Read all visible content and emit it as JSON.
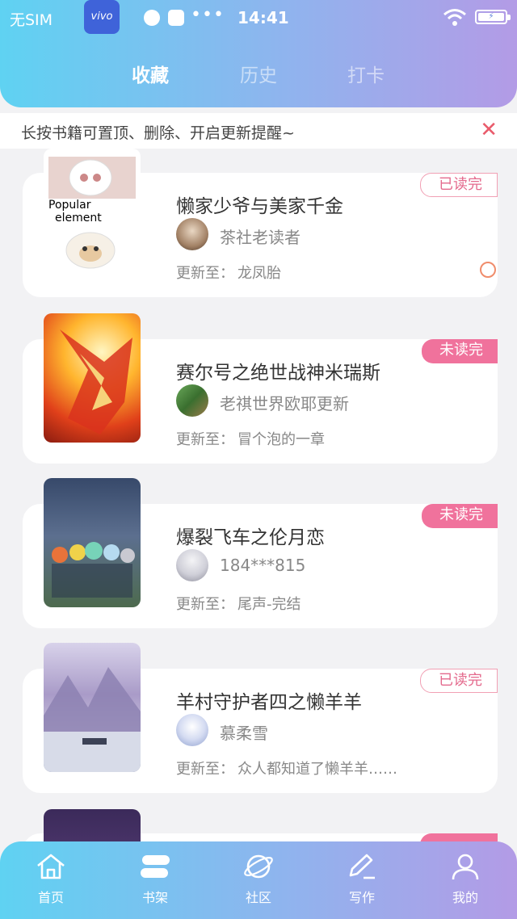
{
  "status_bar": {
    "carrier": "无SIM",
    "brand": "vivo",
    "time": "14:41"
  },
  "tabs": [
    {
      "label": "收藏",
      "active": true
    },
    {
      "label": "历史",
      "active": false
    },
    {
      "label": "打卡",
      "active": false
    }
  ],
  "notice": {
    "text": "长按书籍可置顶、删除、开启更新提醒~"
  },
  "update_prefix": "更新至：",
  "books": [
    {
      "title": "懒家少爷与美家千金",
      "author": "茶社老读者",
      "update": "龙凤胎",
      "status": "已读完",
      "read": true,
      "cover_text_1": "Popular",
      "cover_text_2": "element"
    },
    {
      "title": "赛尔号之绝世战神米瑞斯",
      "author": "老祺世界欧耶更新",
      "update": "冒个泡的一章",
      "status": "未读完",
      "read": false
    },
    {
      "title": "爆裂飞车之伦月恋",
      "author": "184***815",
      "update": "尾声-完结",
      "status": "未读完",
      "read": false
    },
    {
      "title": "羊村守护者四之懒羊羊",
      "author": "慕柔雪",
      "update": "众人都知道了懒羊羊……",
      "status": "已读完",
      "read": true
    }
  ],
  "nav": [
    {
      "label": "首页",
      "icon": "home-icon"
    },
    {
      "label": "书架",
      "icon": "bookshelf-icon"
    },
    {
      "label": "社区",
      "icon": "planet-icon"
    },
    {
      "label": "写作",
      "icon": "pen-icon"
    },
    {
      "label": "我的",
      "icon": "user-icon"
    }
  ],
  "colors": {
    "header_start": "#5fd2f2",
    "header_end": "#b39be6",
    "badge_unread": "#f0729c",
    "badge_read_text": "#e46a8d",
    "close": "#e95b6b"
  }
}
